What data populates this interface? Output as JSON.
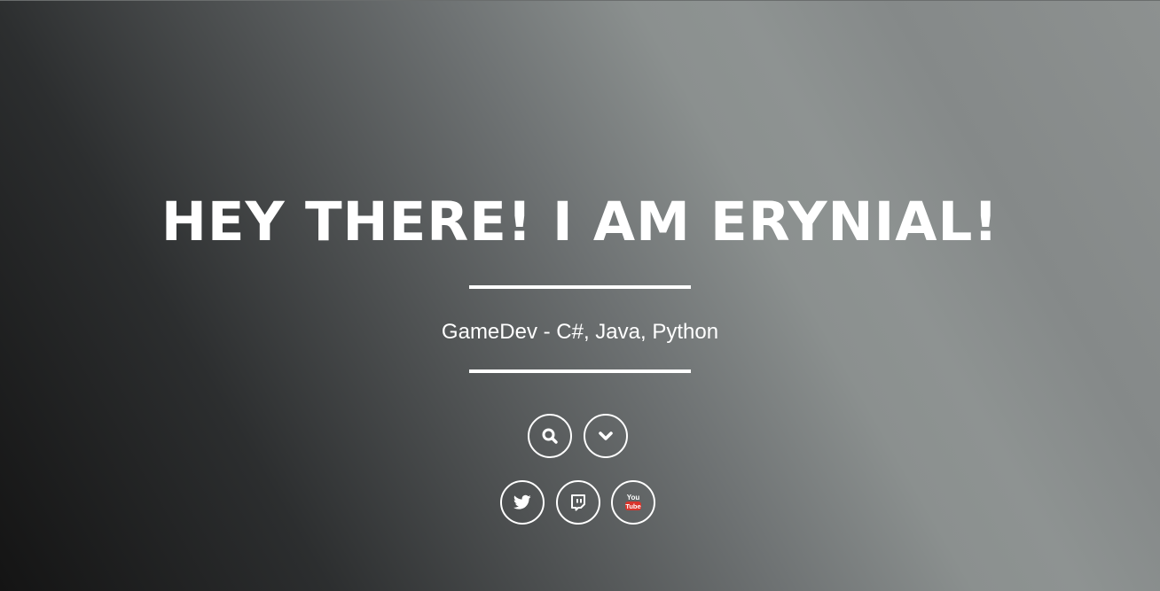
{
  "hero": {
    "title": "HEY THERE! I AM ERYNIAL!",
    "subtitle": "GameDev - C#, Java, Python"
  },
  "actions": [
    {
      "name": "search",
      "icon": "search-icon"
    },
    {
      "name": "scroll-down",
      "icon": "chevron-down-icon"
    }
  ],
  "social": [
    {
      "name": "twitter",
      "icon": "twitter-icon"
    },
    {
      "name": "twitch",
      "icon": "twitch-icon"
    },
    {
      "name": "youtube",
      "icon": "youtube-icon",
      "icon_text_top": "You",
      "icon_text_bottom": "Tube"
    }
  ],
  "colors": {
    "text": "#ffffff",
    "gradient_dark": "#141414",
    "gradient_light": "#8e9392",
    "youtube_red": "#d8352c"
  }
}
